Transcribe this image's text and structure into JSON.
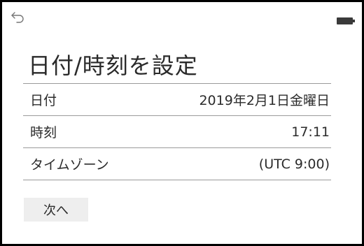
{
  "header": {
    "back_icon": "back-arrow-icon",
    "battery_icon": "battery-icon"
  },
  "title": "日付/時刻を設定",
  "settings": [
    {
      "label": "日付",
      "value": "2019年2月1日金曜日"
    },
    {
      "label": "時刻",
      "value": "17:11"
    },
    {
      "label": "タイムゾーン",
      "value": "(UTC 9:00)"
    }
  ],
  "next_button": "次へ",
  "colors": {
    "divider": "#9a9a9a",
    "button_bg": "#eeeeee",
    "text": "#2b2b2b"
  }
}
